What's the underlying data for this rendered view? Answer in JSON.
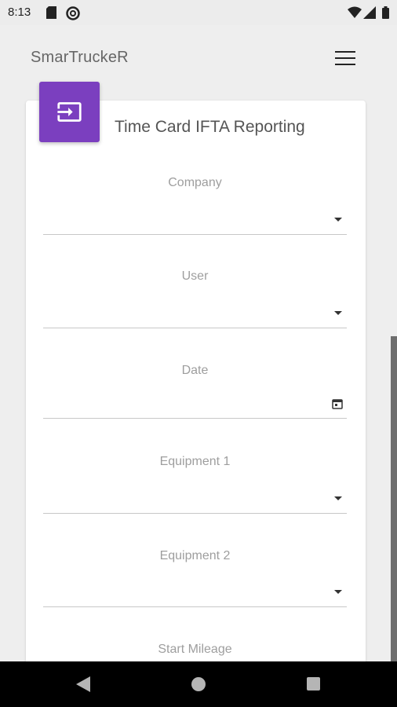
{
  "status_bar": {
    "time": "8:13",
    "icons": [
      "sd-card-icon",
      "do-not-disturb-icon",
      "wifi-icon",
      "signal-icon",
      "battery-icon"
    ]
  },
  "app_bar": {
    "title": "SmarTruckeR",
    "menu_icon": "hamburger-menu-icon"
  },
  "card": {
    "icon": "input-icon",
    "icon_color": "#7b3fbf",
    "title": "Time Card IFTA Reporting"
  },
  "fields": {
    "company": {
      "label": "Company",
      "value": ""
    },
    "user": {
      "label": "User",
      "value": ""
    },
    "date": {
      "label": "Date",
      "value": ""
    },
    "equipment1": {
      "label": "Equipment 1",
      "value": ""
    },
    "equipment2": {
      "label": "Equipment 2",
      "value": ""
    },
    "start_mileage": {
      "label": "Start Mileage",
      "value": ""
    }
  },
  "nav_bar": {
    "buttons": [
      "back-icon",
      "home-icon",
      "recents-icon"
    ]
  }
}
